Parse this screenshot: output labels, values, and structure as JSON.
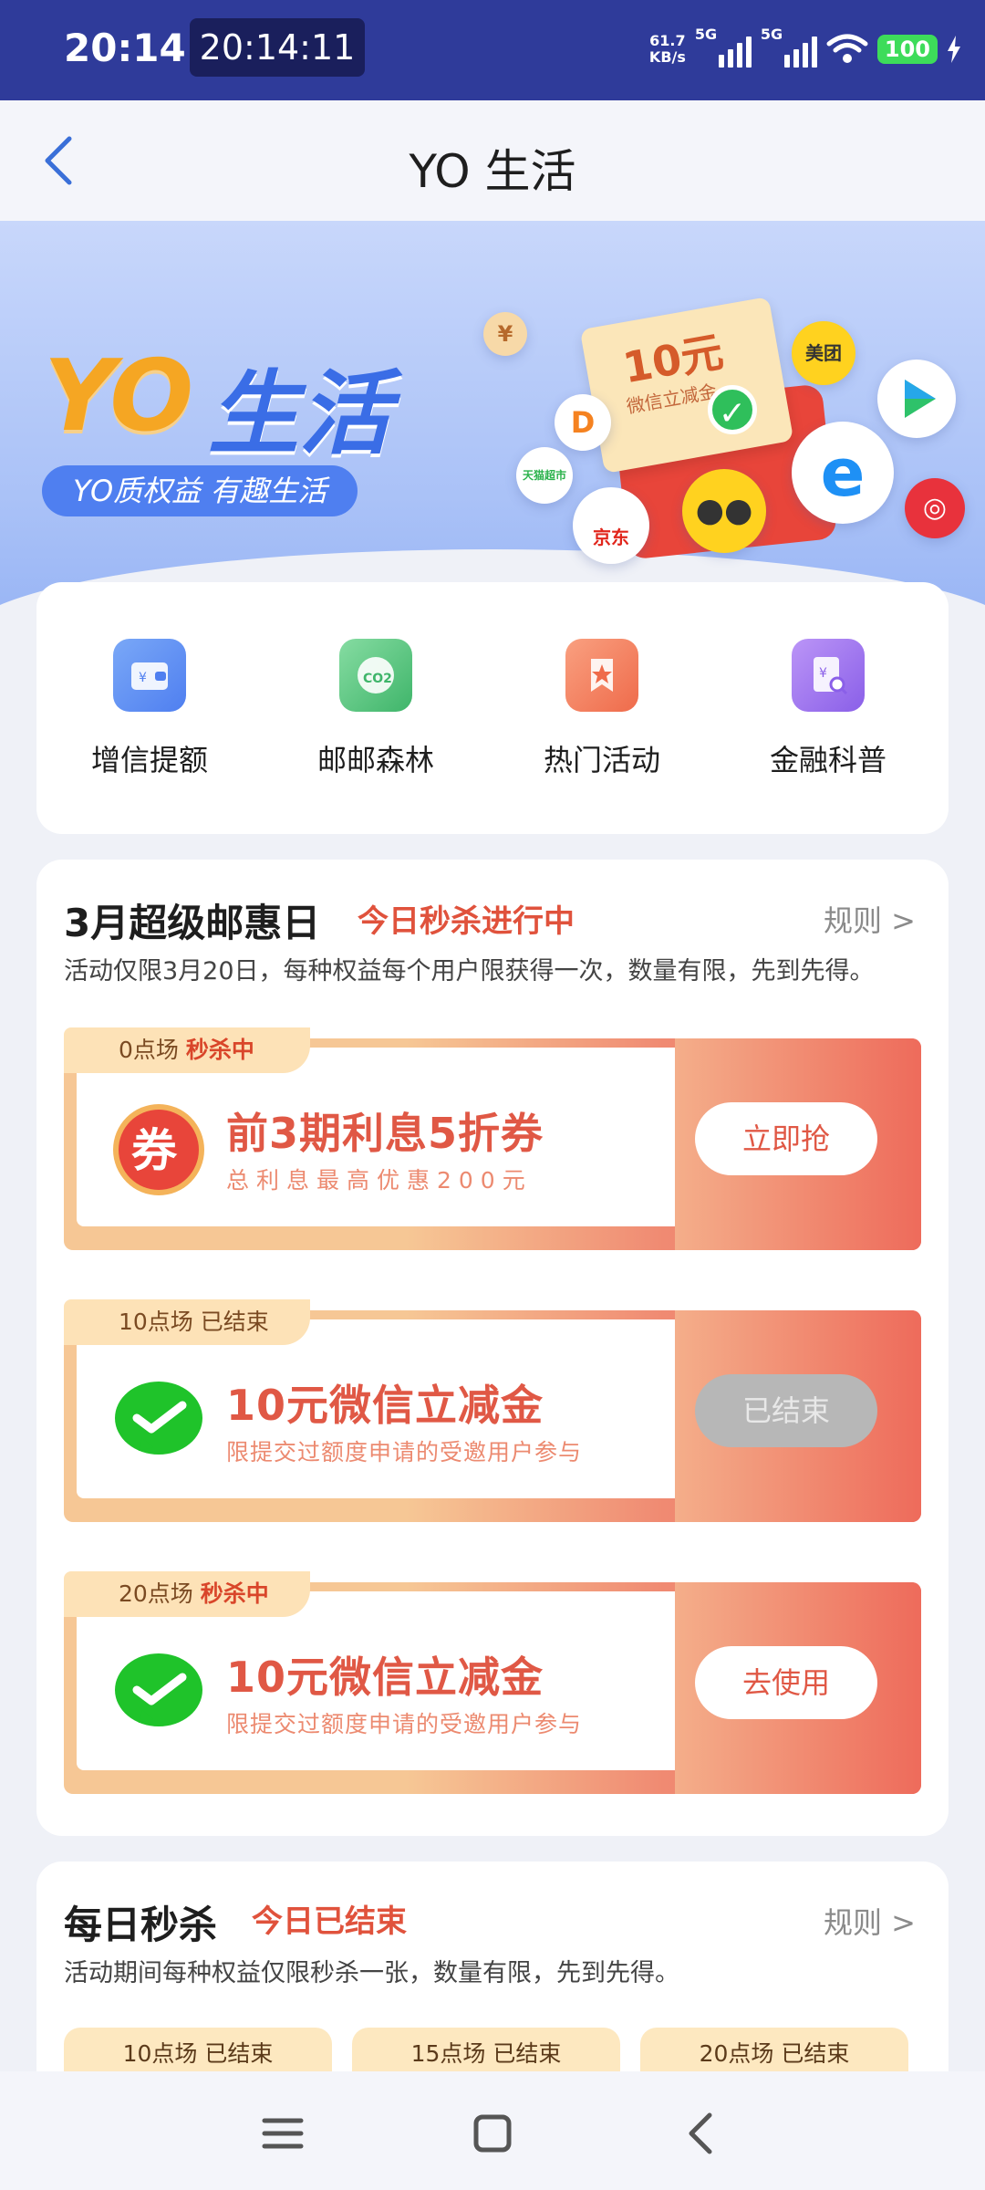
{
  "status_bar": {
    "time": "20:14",
    "clock_chip": "20:14:11",
    "net_speed_value": "61.7",
    "net_speed_unit": "KB/s",
    "sim1_label": "5G",
    "sim2_label": "5G",
    "battery": "100"
  },
  "header": {
    "title": "YO 生活"
  },
  "banner": {
    "title_yo": "YO",
    "title_life": "生活",
    "slogan": "YO质权益 有趣生活",
    "coupon_value": "10元",
    "coupon_sub": "微信立减金",
    "brand_meituan": "美团",
    "brand_jd": "京东",
    "brand_tmall": "天猫超市"
  },
  "quick_entries": [
    {
      "label": "增信提额",
      "icon": "wallet-icon",
      "color": "#5b8def"
    },
    {
      "label": "邮邮森林",
      "icon": "co2-cloud-icon",
      "color": "#4cc37a"
    },
    {
      "label": "热门活动",
      "icon": "bookmark-star-icon",
      "color": "#f26a4b"
    },
    {
      "label": "金融科普",
      "icon": "finance-doc-icon",
      "color": "#9c6cf0"
    }
  ],
  "section_march": {
    "title": "3月超级邮惠日",
    "status": "今日秒杀进行中",
    "rule": "规则 >",
    "desc": "活动仅限3月20日，每种权益每个用户限获得一次，数量有限，先到先得。",
    "deals": [
      {
        "session": "0点场",
        "state": "秒杀中",
        "name": "前3期利息5折券",
        "sub": "总利息最高优惠200元",
        "button": "立即抢",
        "icon": "coupon-icon"
      },
      {
        "session": "10点场",
        "state": "已结束",
        "name": "10元微信立减金",
        "sub": "限提交过额度申请的受邀用户参与",
        "button": "已结束",
        "icon": "wechat-icon"
      },
      {
        "session": "20点场",
        "state": "秒杀中",
        "name": "10元微信立减金",
        "sub": "限提交过额度申请的受邀用户参与",
        "button": "去使用",
        "icon": "wechat-icon"
      }
    ]
  },
  "section_daily": {
    "title": "每日秒杀",
    "status": "今日已结束",
    "rule": "规则 >",
    "desc": "活动期间每种权益仅限秒杀一张，数量有限，先到先得。",
    "sessions": [
      "10点场 已结束",
      "15点场 已结束",
      "20点场 已结束"
    ]
  },
  "colors": {
    "status_bar_bg": "#2f3b9a",
    "accent_red": "#e0523c",
    "battery_green": "#3ddc5a"
  }
}
